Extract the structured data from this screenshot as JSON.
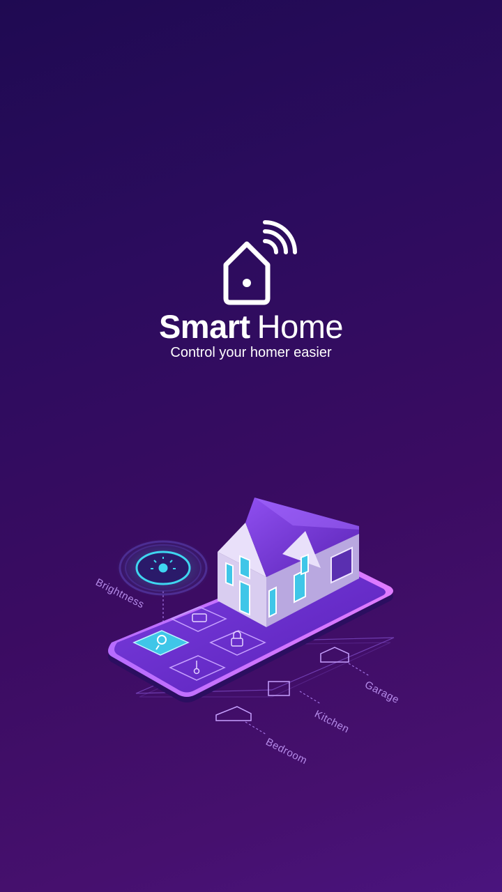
{
  "brand": {
    "title_bold": "Smart",
    "title_light": "Home",
    "tagline": "Control your homer easier"
  },
  "illustration": {
    "labels": {
      "brightness": "Brightness",
      "garage": "Garage",
      "kitchen": "Kitchen",
      "bedroom": "Bedroom"
    }
  },
  "colors": {
    "background_start": "#1f0a52",
    "background_end": "#4a147e",
    "accent_cyan": "#3fd6f0",
    "accent_purple": "#8a3ff0"
  }
}
